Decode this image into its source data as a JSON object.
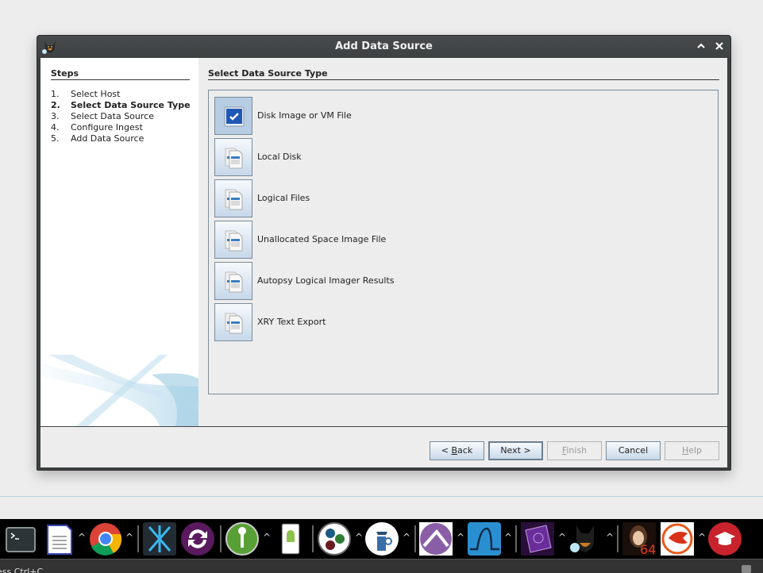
{
  "dialog": {
    "title": "Add Data Source",
    "icon": "autopsy-dog-icon",
    "controls": {
      "minimize": "^",
      "close": "✕"
    }
  },
  "steps": {
    "title": "Steps",
    "items": [
      {
        "num": "1.",
        "label": "Select Host",
        "active": false
      },
      {
        "num": "2.",
        "label": "Select Data Source Type",
        "active": true
      },
      {
        "num": "3.",
        "label": "Select Data Source",
        "active": false
      },
      {
        "num": "4.",
        "label": "Configure Ingest",
        "active": false
      },
      {
        "num": "5.",
        "label": "Add Data Source",
        "active": false
      }
    ]
  },
  "main": {
    "title": "Select Data Source Type",
    "types": [
      {
        "label": "Disk Image or VM File",
        "icon": "disk-image-icon",
        "selected": true
      },
      {
        "label": "Local Disk",
        "icon": "documents-icon",
        "selected": false
      },
      {
        "label": "Logical Files",
        "icon": "documents-icon",
        "selected": false
      },
      {
        "label": "Unallocated Space Image File",
        "icon": "documents-icon",
        "selected": false
      },
      {
        "label": "Autopsy Logical Imager Results",
        "icon": "documents-icon",
        "selected": false
      },
      {
        "label": "XRY Text Export",
        "icon": "documents-icon",
        "selected": false
      }
    ]
  },
  "buttons": {
    "back": {
      "prefix": "< ",
      "mnemonic": "B",
      "rest": "ack",
      "enabled": true
    },
    "next": {
      "label": "Next >",
      "enabled": true
    },
    "finish": {
      "mnemonic": "F",
      "rest": "inish",
      "enabled": false
    },
    "cancel": {
      "label": "Cancel",
      "enabled": true
    },
    "help": {
      "mnemonic": "H",
      "rest": "elp",
      "enabled": false
    }
  },
  "taskbar": {
    "apps": [
      "terminal-icon",
      "text-editor-icon",
      "chrome-icon",
      "cross-icon",
      "sync-icon",
      "keepass-icon",
      "android-icon",
      "three-dots-icon",
      "detective-icon",
      "pickaxe-icon",
      "wireshark-icon",
      "forensic-notebook-icon",
      "autopsy-icon",
      "portrait-64-icon",
      "dragon-icon",
      "graduation-cap-icon"
    ]
  },
  "status": {
    "text": "ess Ctrl+C"
  }
}
